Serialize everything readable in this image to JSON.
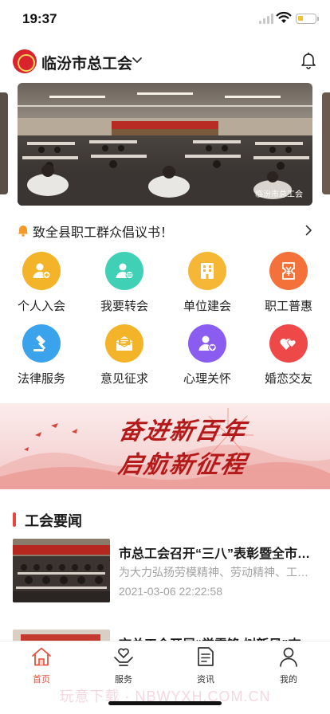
{
  "status_bar": {
    "time": "19:37",
    "battery_level": 0.3,
    "battery_color": "#f2c230"
  },
  "header": {
    "org_name": "临汾市总工会",
    "org_icon": "union-emblem-icon",
    "chevron_icon": "chevron-down-icon",
    "bell_icon": "bell-icon"
  },
  "banner": {
    "watermark": "临汾市总工会",
    "pages": 3
  },
  "notice": {
    "icon": "notice-bell-icon",
    "text": "致全县职工群众倡议书！",
    "arrow_icon": "chevron-right-icon"
  },
  "services": [
    {
      "label": "个人入会",
      "icon": "user-add-icon",
      "color": "#f4b42a"
    },
    {
      "label": "我要转会",
      "icon": "user-transfer-icon",
      "color": "#3fd0b6"
    },
    {
      "label": "单位建会",
      "icon": "building-icon",
      "color": "#f6b636"
    },
    {
      "label": "职工普惠",
      "icon": "ticket-icon",
      "color": "#f4713a"
    },
    {
      "label": "法律服务",
      "icon": "gavel-icon",
      "color": "#3aa3ec"
    },
    {
      "label": "意见征求",
      "icon": "mail-icon",
      "color": "#f4b42a"
    },
    {
      "label": "心理关怀",
      "icon": "user-heart-icon",
      "color": "#8a5cf0"
    },
    {
      "label": "婚恋交友",
      "icon": "hearts-icon",
      "color": "#ee4848"
    }
  ],
  "promo": {
    "line1": "奋进新百年",
    "line2": "启航新征程",
    "accent": "#b51a1a"
  },
  "news": {
    "section_title": "工会要闻",
    "accent": "#e5473f",
    "items": [
      {
        "title": "市总工会召开“三八”表彰暨全市女职工工作会议",
        "summary": "为大力弘扬劳模精神、劳动精神、工匠精神",
        "date": "2021-03-06 22:22:58"
      },
      {
        "title": "市总工会开展“学雷锋 树新风”志愿服务活动",
        "summary": "",
        "date": ""
      }
    ]
  },
  "tabbar": {
    "active_color": "#e8503a",
    "tabs": [
      {
        "label": "首页",
        "icon": "home-icon"
      },
      {
        "label": "服务",
        "icon": "heart-hand-icon"
      },
      {
        "label": "资讯",
        "icon": "document-icon"
      },
      {
        "label": "我的",
        "icon": "user-icon"
      }
    ]
  },
  "watermark": "玩意下载 · NBWYXH.COM.CN"
}
